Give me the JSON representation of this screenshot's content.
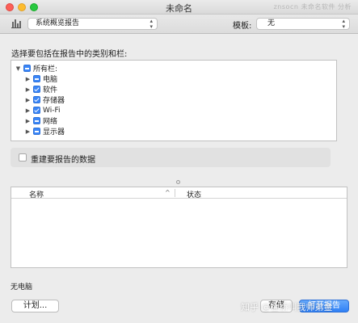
{
  "window": {
    "title": "未命名",
    "watermark": "znsocn 未命名软件 分析"
  },
  "toolbar": {
    "report_type": "系统概览报告",
    "template_label": "模板:",
    "template_value": "无"
  },
  "prompt": "选择要包括在报告中的类别和栏:",
  "tree": {
    "root": {
      "label": "所有栏:",
      "state": "mixed"
    },
    "items": [
      {
        "label": "电脑",
        "state": "mixed"
      },
      {
        "label": "软件",
        "state": "checked"
      },
      {
        "label": "存储器",
        "state": "checked"
      },
      {
        "label": "Wi-Fi",
        "state": "checked"
      },
      {
        "label": "网络",
        "state": "mixed"
      },
      {
        "label": "显示器",
        "state": "mixed"
      }
    ]
  },
  "rebuild_label": "重建要报告的数据",
  "table": {
    "columns": [
      "名称",
      "状态"
    ],
    "sort_indicator": "^"
  },
  "status_text": "无电脑",
  "buttons": {
    "plan": "计划...",
    "save": "存储",
    "open": "打开报告"
  },
  "overlay_watermark": "知乎 @金桥叫我师弟金"
}
